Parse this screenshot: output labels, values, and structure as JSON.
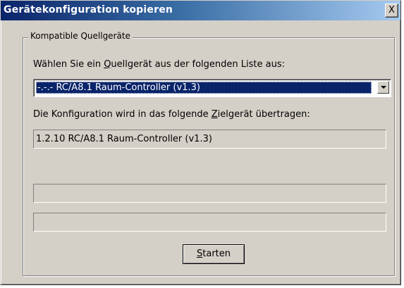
{
  "window": {
    "title": "Gerätekonfiguration kopieren",
    "close_glyph": "X"
  },
  "group": {
    "label": "Kompatible Quellgeräte"
  },
  "source": {
    "label_before": "Wählen Sie ein ",
    "label_mnemonic": "Q",
    "label_after": "uellgerät aus der folgenden Liste aus:",
    "selected_value": "-.-.- RC/A8.1 Raum-Controller (v1.3)"
  },
  "target": {
    "label_before": "Die Konfiguration wird in das folgende ",
    "label_mnemonic": "Z",
    "label_after": "ielgerät übertragen:",
    "value": "1.2.10 RC/A8.1 Raum-Controller (v1.3)"
  },
  "status": {
    "line1": "",
    "line2": ""
  },
  "start_button": {
    "mnemonic": "S",
    "rest": "tarten"
  }
}
